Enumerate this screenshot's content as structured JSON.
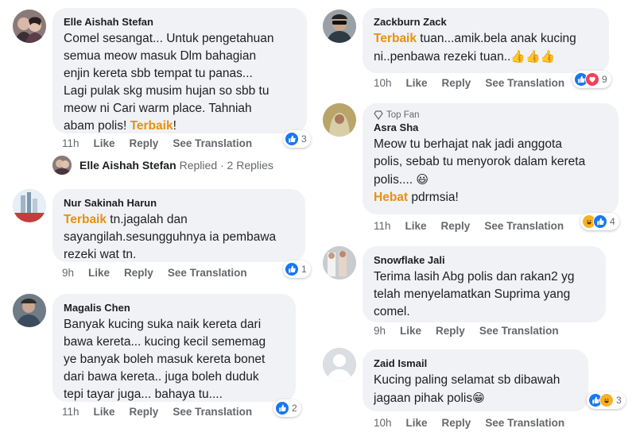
{
  "comments_left": [
    {
      "name": "Elle Aishah Stefan",
      "text": "Comel sesangat... Untuk pengetahuan\nsemua meow masuk Dlm bahagian\nenjin kereta sbb tempat tu panas...\nLagi pulak skg musim hujan so sbb tu\nmeow ni Cari warm place. Tahniah\nabam polis! ",
      "keyword": "Terbaik",
      "suffix": "!",
      "time": "11h",
      "like": "Like",
      "reply": "Reply",
      "translate": "See Translation",
      "reaction_count": "3"
    },
    {
      "name": "Nur Sakinah Harun",
      "keyword": "Terbaik",
      "text": " tn.jagalah dan\nsayangilah.sesungguhnya ia pembawa\nrezeki wat tn.",
      "time": "9h",
      "like": "Like",
      "reply": "Reply",
      "translate": "See Translation",
      "reaction_count": "1"
    },
    {
      "name": "Magalis Chen",
      "text": "Banyak kucing suka naik kereta dari\nbawa kereta... kucing kecil sememag\nye banyak boleh masuk kereta bonet\ndari bawa kereta.. juga boleh duduk\ntepi tayar juga... bahaya tu....",
      "time": "11h",
      "like": "Like",
      "reply": "Reply",
      "translate": "See Translation",
      "reaction_count": "2"
    }
  ],
  "replies_row": {
    "name": "Elle Aishah Stefan",
    "link": "Replied · 2 Replies"
  },
  "comments_right": [
    {
      "name": "Zackburn Zack",
      "keyword": "Terbaik",
      "text": " tuan...amik.bela anak kucing\nni..penbawa rezeki tuan..",
      "emoji": "👍👍👍",
      "time": "10h",
      "like": "Like",
      "reply": "Reply",
      "translate": "See Translation",
      "reaction_count": "9"
    },
    {
      "badge": "Top Fan",
      "name": "Asra Sha",
      "text": "Meow tu berhajat nak jadi anggota\npolis, sebab tu menyorok dalam kereta\npolis.... ",
      "emoji": "😃",
      "keyword2": "Hebat",
      "text2": " pdrmsia!",
      "time": "11h",
      "like": "Like",
      "reply": "Reply",
      "translate": "See Translation",
      "reaction_count": "4"
    },
    {
      "name": "Snowflake Jali",
      "text": "Terima lasih Abg polis dan rakan2 yg\ntelah menyelamatkan Suprima yang\ncomel.",
      "time": "9h",
      "like": "Like",
      "reply": "Reply",
      "translate": "See Translation"
    },
    {
      "name": "Zaid Ismail",
      "text": "Kucing paling selamat sb dibawah\njagaan pihak polis",
      "emoji": "😁",
      "time": "10h",
      "like": "Like",
      "reply": "Reply",
      "translate": "See Translation",
      "reaction_count": "3"
    }
  ],
  "colors": {
    "bubble": "#f0f2f5",
    "keyword": "#e8910e",
    "meta": "#65676b",
    "like": "#1877f2",
    "love": "#f33e58",
    "haha": "#f7b125"
  }
}
